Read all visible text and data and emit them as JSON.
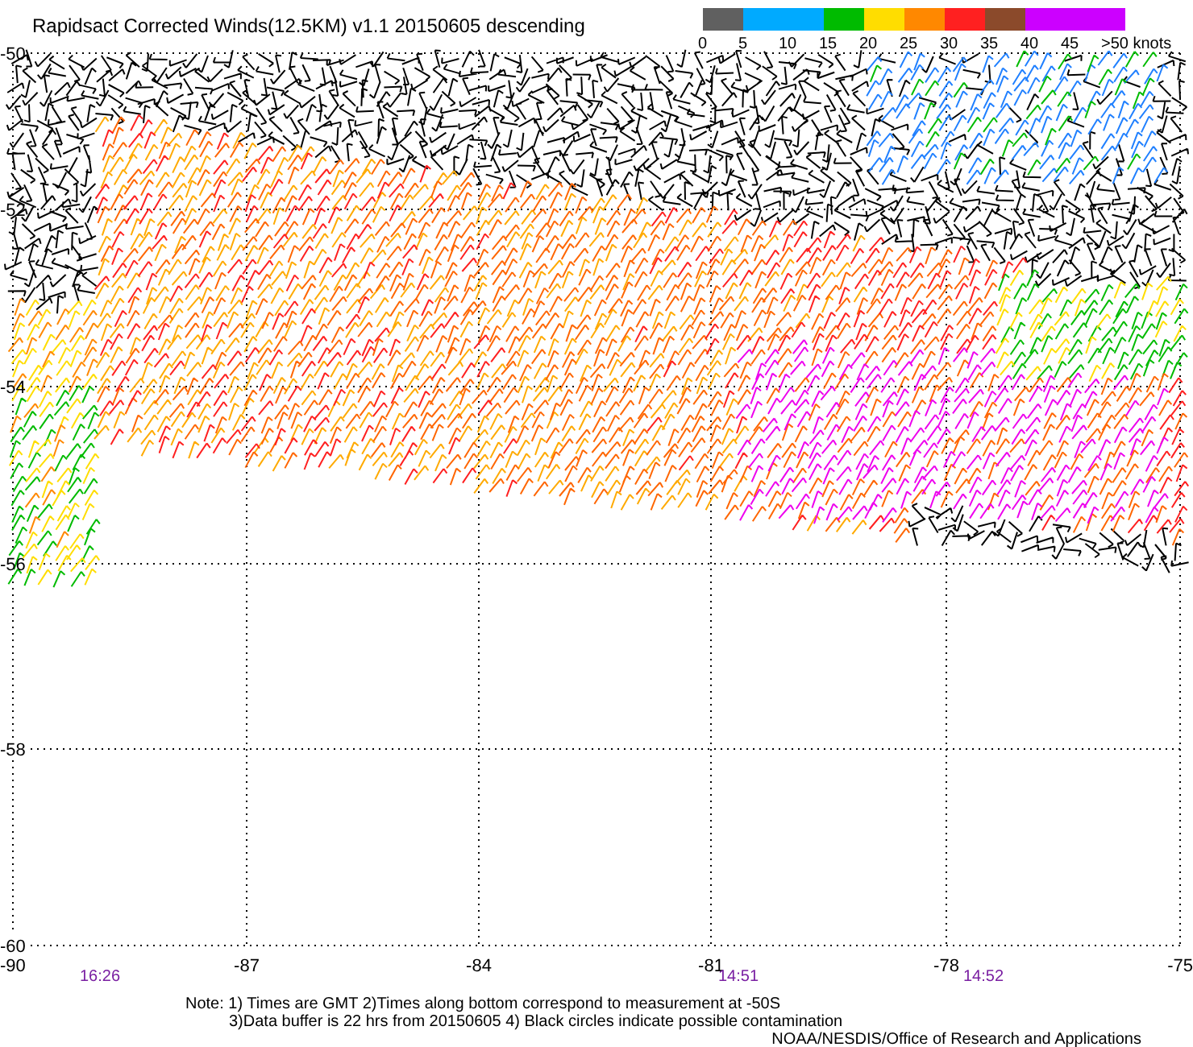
{
  "title": "Rapidsact Corrected Winds(12.5KM) v1.1 20150605 descending",
  "legend": {
    "segments": [
      {
        "color": "#606060"
      },
      {
        "color": "#00aaff"
      },
      {
        "color": "#00bb00"
      },
      {
        "color": "#ffdd00"
      },
      {
        "color": "#ff8800"
      },
      {
        "color": "#ff2020"
      },
      {
        "color": "#8b4a2b"
      },
      {
        "color": "#cc00ff"
      }
    ],
    "labels": [
      "0",
      "5",
      "10",
      "15",
      "20",
      "25",
      "30",
      "35",
      "40",
      "45",
      ">50 knots"
    ]
  },
  "y_ticks": [
    "-50",
    "-52",
    "-54",
    "-56",
    "-58",
    "-60"
  ],
  "x_ticks": [
    "-90",
    "-87",
    "-84",
    "-81",
    "-78",
    "-75"
  ],
  "times": [
    "16:26",
    "14:51",
    "14:52"
  ],
  "notes": [
    "Note: 1) Times are GMT 2)Times along bottom correspond to measurement at -50S",
    "3)Data buffer is 22 hrs from 20150605 4) Black circles indicate possible contamination"
  ],
  "credit": "NOAA/NESDIS/Office of Research and Applications"
}
